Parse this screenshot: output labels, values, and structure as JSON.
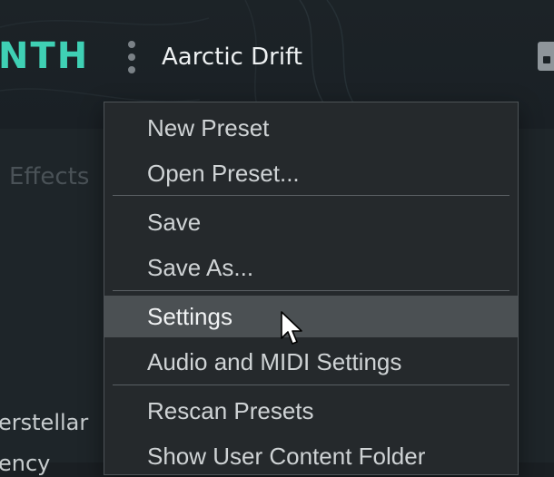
{
  "header": {
    "logo_text": "NTH",
    "preset_name": "Aarctic Drift"
  },
  "tabs": {
    "effects_label": "Effects"
  },
  "preset_list": {
    "items": [
      "erstellar",
      "ency"
    ]
  },
  "menu": {
    "groups": [
      {
        "items": [
          {
            "label": "New Preset"
          },
          {
            "label": "Open Preset..."
          }
        ]
      },
      {
        "items": [
          {
            "label": "Save"
          },
          {
            "label": "Save As..."
          }
        ]
      },
      {
        "items": [
          {
            "label": "Settings",
            "highlighted": true
          },
          {
            "label": "Audio and MIDI Settings"
          }
        ]
      },
      {
        "items": [
          {
            "label": "Rescan Presets"
          },
          {
            "label": "Show User Content Folder"
          }
        ]
      }
    ]
  },
  "colors": {
    "accent": "#3fd0b4",
    "background": "#1a1f23",
    "menu_background": "#25292c",
    "menu_highlight": "#4b5053"
  }
}
